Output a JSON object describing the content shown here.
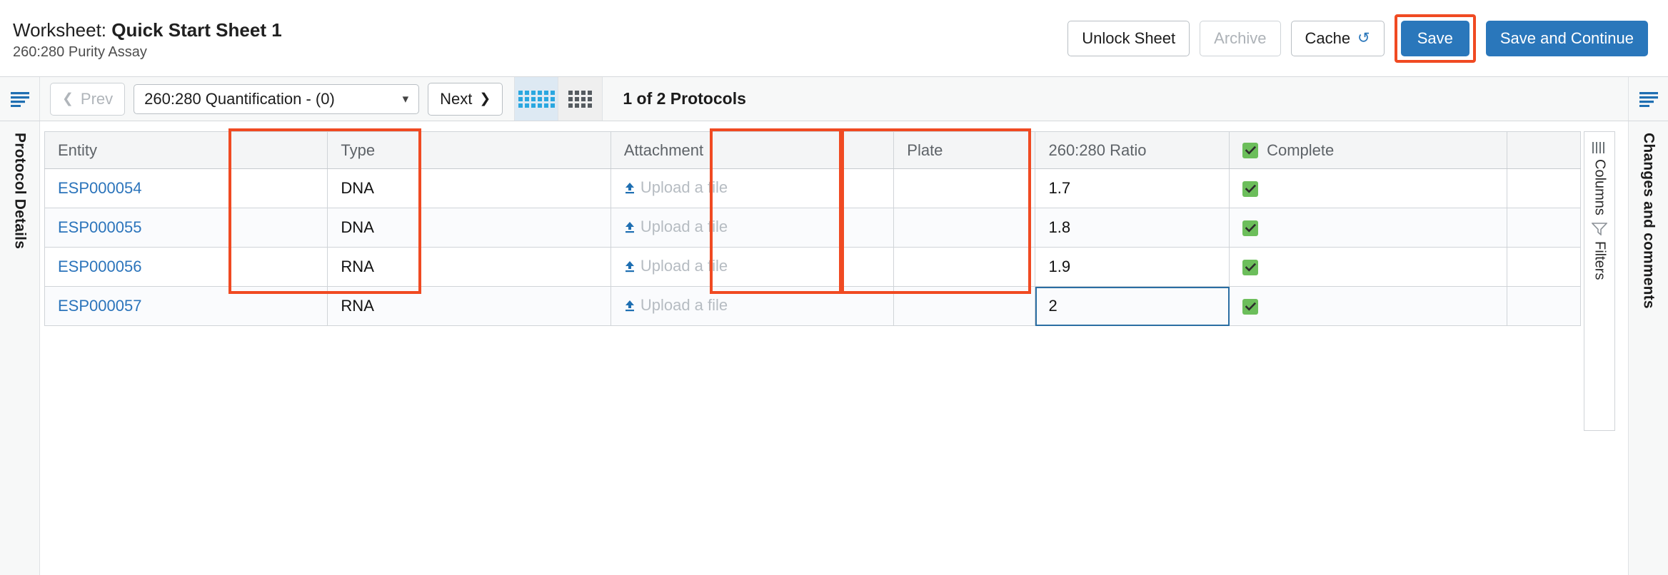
{
  "header": {
    "worksheet_prefix": "Worksheet: ",
    "worksheet_name": "Quick Start Sheet 1",
    "subtitle": "260:280 Purity Assay",
    "buttons": {
      "unlock": "Unlock Sheet",
      "archive": "Archive",
      "cache": "Cache",
      "cache_icon": "refresh-icon",
      "save": "Save",
      "save_and_continue": "Save and Continue"
    }
  },
  "toolbar": {
    "left_rail_icon": "menu-icon",
    "prev_label": "Prev",
    "prev_icon": "chevron-left-icon",
    "protocol_select_value": "260:280 Quantification - (0)",
    "protocol_select_caret": "chevron-down-icon",
    "next_label": "Next",
    "next_icon": "chevron-right-icon",
    "view_toggle_1_icon": "compact-grid-icon",
    "view_toggle_2_icon": "dense-grid-icon",
    "protocol_count": "1 of 2 Protocols",
    "right_rail_icon": "menu-icon"
  },
  "sidebars": {
    "left_label": "Protocol Details",
    "right_label": "Changes and comments"
  },
  "side_panel": {
    "columns_label": "Columns",
    "columns_icon": "columns-icon",
    "filters_label": "Filters",
    "filters_icon": "funnel-icon"
  },
  "table": {
    "columns": [
      {
        "key": "entity",
        "label": "Entity"
      },
      {
        "key": "type",
        "label": "Type"
      },
      {
        "key": "attachment",
        "label": "Attachment"
      },
      {
        "key": "plate",
        "label": "Plate"
      },
      {
        "key": "ratio",
        "label": "260:280 Ratio"
      },
      {
        "key": "complete",
        "label": "Complete",
        "has_checkbox": true
      }
    ],
    "upload_placeholder": "Upload a file",
    "upload_icon": "upload-icon",
    "rows": [
      {
        "entity": "ESP000054",
        "type": "DNA",
        "attachment": "",
        "plate": "",
        "ratio": "1.7",
        "complete": true
      },
      {
        "entity": "ESP000055",
        "type": "DNA",
        "attachment": "",
        "plate": "",
        "ratio": "1.8",
        "complete": true
      },
      {
        "entity": "ESP000056",
        "type": "RNA",
        "attachment": "",
        "plate": "",
        "ratio": "1.9",
        "complete": true
      },
      {
        "entity": "ESP000057",
        "type": "RNA",
        "attachment": "",
        "plate": "",
        "ratio": "2",
        "complete": true
      }
    ],
    "active_cell": {
      "row": 3,
      "column": "ratio"
    }
  },
  "annotations": {
    "highlight_color": "#f04a22",
    "regions": [
      {
        "name": "type-column-highlight"
      },
      {
        "name": "ratio-column-highlight"
      },
      {
        "name": "complete-column-highlight"
      },
      {
        "name": "save-button-highlight"
      }
    ]
  }
}
